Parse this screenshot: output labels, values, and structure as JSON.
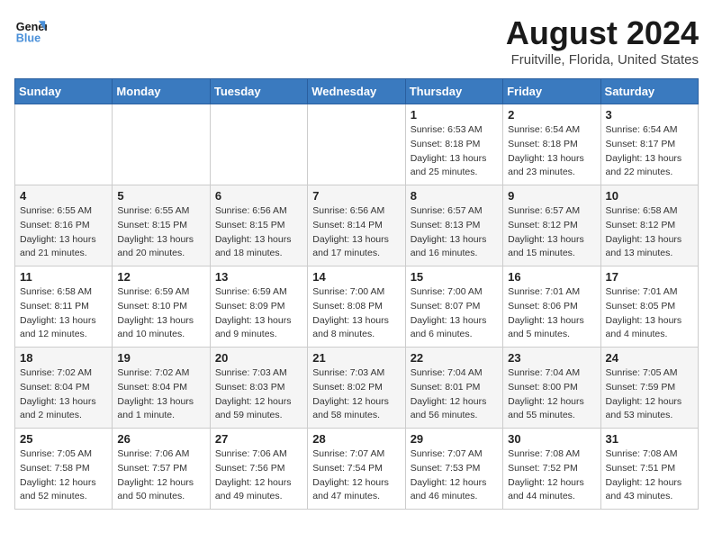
{
  "logo": {
    "line1": "General",
    "line2": "Blue"
  },
  "title": "August 2024",
  "location": "Fruitville, Florida, United States",
  "days_of_week": [
    "Sunday",
    "Monday",
    "Tuesday",
    "Wednesday",
    "Thursday",
    "Friday",
    "Saturday"
  ],
  "weeks": [
    [
      {
        "day": "",
        "info": ""
      },
      {
        "day": "",
        "info": ""
      },
      {
        "day": "",
        "info": ""
      },
      {
        "day": "",
        "info": ""
      },
      {
        "day": "1",
        "info": "Sunrise: 6:53 AM\nSunset: 8:18 PM\nDaylight: 13 hours\nand 25 minutes."
      },
      {
        "day": "2",
        "info": "Sunrise: 6:54 AM\nSunset: 8:18 PM\nDaylight: 13 hours\nand 23 minutes."
      },
      {
        "day": "3",
        "info": "Sunrise: 6:54 AM\nSunset: 8:17 PM\nDaylight: 13 hours\nand 22 minutes."
      }
    ],
    [
      {
        "day": "4",
        "info": "Sunrise: 6:55 AM\nSunset: 8:16 PM\nDaylight: 13 hours\nand 21 minutes."
      },
      {
        "day": "5",
        "info": "Sunrise: 6:55 AM\nSunset: 8:15 PM\nDaylight: 13 hours\nand 20 minutes."
      },
      {
        "day": "6",
        "info": "Sunrise: 6:56 AM\nSunset: 8:15 PM\nDaylight: 13 hours\nand 18 minutes."
      },
      {
        "day": "7",
        "info": "Sunrise: 6:56 AM\nSunset: 8:14 PM\nDaylight: 13 hours\nand 17 minutes."
      },
      {
        "day": "8",
        "info": "Sunrise: 6:57 AM\nSunset: 8:13 PM\nDaylight: 13 hours\nand 16 minutes."
      },
      {
        "day": "9",
        "info": "Sunrise: 6:57 AM\nSunset: 8:12 PM\nDaylight: 13 hours\nand 15 minutes."
      },
      {
        "day": "10",
        "info": "Sunrise: 6:58 AM\nSunset: 8:12 PM\nDaylight: 13 hours\nand 13 minutes."
      }
    ],
    [
      {
        "day": "11",
        "info": "Sunrise: 6:58 AM\nSunset: 8:11 PM\nDaylight: 13 hours\nand 12 minutes."
      },
      {
        "day": "12",
        "info": "Sunrise: 6:59 AM\nSunset: 8:10 PM\nDaylight: 13 hours\nand 10 minutes."
      },
      {
        "day": "13",
        "info": "Sunrise: 6:59 AM\nSunset: 8:09 PM\nDaylight: 13 hours\nand 9 minutes."
      },
      {
        "day": "14",
        "info": "Sunrise: 7:00 AM\nSunset: 8:08 PM\nDaylight: 13 hours\nand 8 minutes."
      },
      {
        "day": "15",
        "info": "Sunrise: 7:00 AM\nSunset: 8:07 PM\nDaylight: 13 hours\nand 6 minutes."
      },
      {
        "day": "16",
        "info": "Sunrise: 7:01 AM\nSunset: 8:06 PM\nDaylight: 13 hours\nand 5 minutes."
      },
      {
        "day": "17",
        "info": "Sunrise: 7:01 AM\nSunset: 8:05 PM\nDaylight: 13 hours\nand 4 minutes."
      }
    ],
    [
      {
        "day": "18",
        "info": "Sunrise: 7:02 AM\nSunset: 8:04 PM\nDaylight: 13 hours\nand 2 minutes."
      },
      {
        "day": "19",
        "info": "Sunrise: 7:02 AM\nSunset: 8:04 PM\nDaylight: 13 hours\nand 1 minute."
      },
      {
        "day": "20",
        "info": "Sunrise: 7:03 AM\nSunset: 8:03 PM\nDaylight: 12 hours\nand 59 minutes."
      },
      {
        "day": "21",
        "info": "Sunrise: 7:03 AM\nSunset: 8:02 PM\nDaylight: 12 hours\nand 58 minutes."
      },
      {
        "day": "22",
        "info": "Sunrise: 7:04 AM\nSunset: 8:01 PM\nDaylight: 12 hours\nand 56 minutes."
      },
      {
        "day": "23",
        "info": "Sunrise: 7:04 AM\nSunset: 8:00 PM\nDaylight: 12 hours\nand 55 minutes."
      },
      {
        "day": "24",
        "info": "Sunrise: 7:05 AM\nSunset: 7:59 PM\nDaylight: 12 hours\nand 53 minutes."
      }
    ],
    [
      {
        "day": "25",
        "info": "Sunrise: 7:05 AM\nSunset: 7:58 PM\nDaylight: 12 hours\nand 52 minutes."
      },
      {
        "day": "26",
        "info": "Sunrise: 7:06 AM\nSunset: 7:57 PM\nDaylight: 12 hours\nand 50 minutes."
      },
      {
        "day": "27",
        "info": "Sunrise: 7:06 AM\nSunset: 7:56 PM\nDaylight: 12 hours\nand 49 minutes."
      },
      {
        "day": "28",
        "info": "Sunrise: 7:07 AM\nSunset: 7:54 PM\nDaylight: 12 hours\nand 47 minutes."
      },
      {
        "day": "29",
        "info": "Sunrise: 7:07 AM\nSunset: 7:53 PM\nDaylight: 12 hours\nand 46 minutes."
      },
      {
        "day": "30",
        "info": "Sunrise: 7:08 AM\nSunset: 7:52 PM\nDaylight: 12 hours\nand 44 minutes."
      },
      {
        "day": "31",
        "info": "Sunrise: 7:08 AM\nSunset: 7:51 PM\nDaylight: 12 hours\nand 43 minutes."
      }
    ]
  ]
}
